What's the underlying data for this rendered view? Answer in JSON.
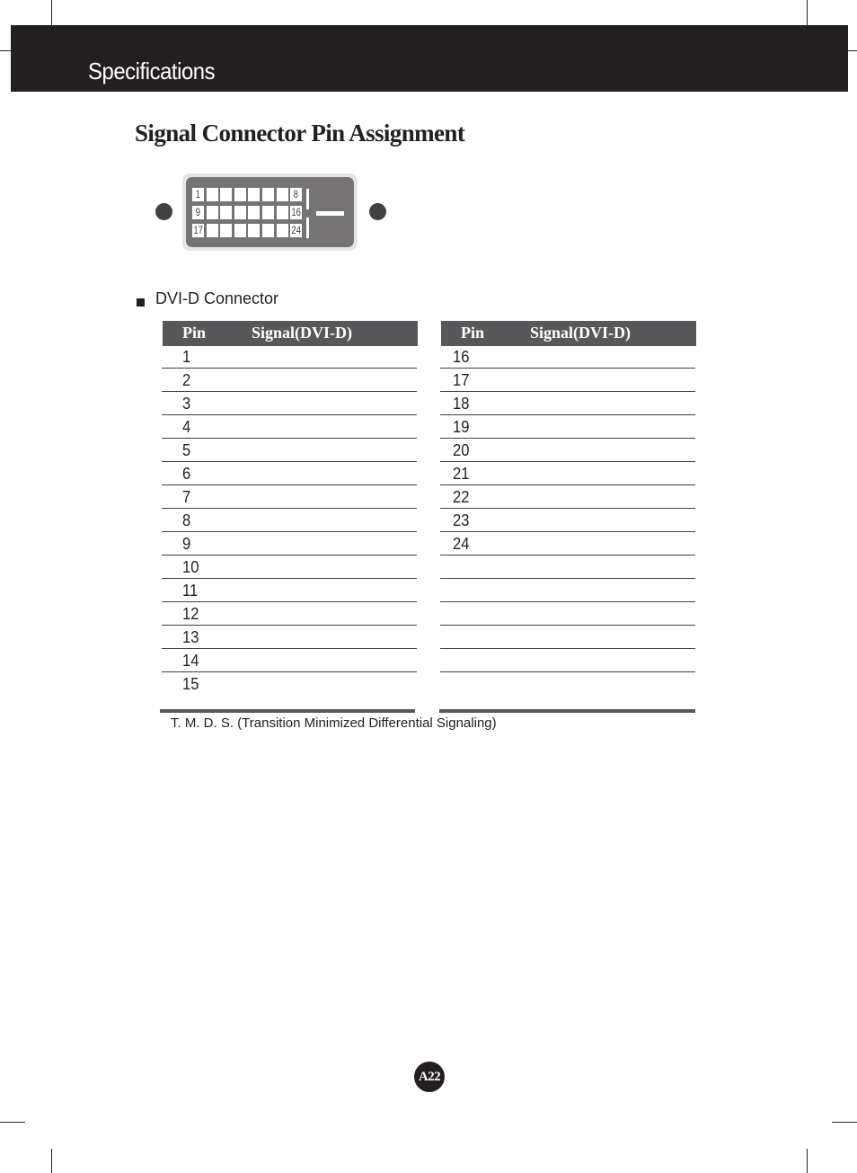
{
  "header": {
    "title": "Specifications"
  },
  "page_title": "Signal Connector Pin Assignment",
  "connector_diagram": {
    "pin_labels": {
      "row1_first": "1",
      "row1_last": "8",
      "row2_first": "9",
      "row2_last": "16",
      "row3_first": "17",
      "row3_last": "24"
    }
  },
  "section": {
    "label": "DVI-D Connector"
  },
  "tables": {
    "left": {
      "headers": {
        "pin": "Pin",
        "signal": "Signal(DVI-D)"
      },
      "rows": [
        {
          "pin": "1",
          "signal": ""
        },
        {
          "pin": "2",
          "signal": ""
        },
        {
          "pin": "3",
          "signal": ""
        },
        {
          "pin": "4",
          "signal": ""
        },
        {
          "pin": "5",
          "signal": ""
        },
        {
          "pin": "6",
          "signal": ""
        },
        {
          "pin": "7",
          "signal": ""
        },
        {
          "pin": "8",
          "signal": ""
        },
        {
          "pin": "9",
          "signal": ""
        },
        {
          "pin": "10",
          "signal": ""
        },
        {
          "pin": "11",
          "signal": ""
        },
        {
          "pin": "12",
          "signal": ""
        },
        {
          "pin": "13",
          "signal": ""
        },
        {
          "pin": "14",
          "signal": ""
        },
        {
          "pin": "15",
          "signal": ""
        }
      ]
    },
    "right": {
      "headers": {
        "pin": "Pin",
        "signal": "Signal(DVI-D)"
      },
      "rows": [
        {
          "pin": "16",
          "signal": ""
        },
        {
          "pin": "17",
          "signal": ""
        },
        {
          "pin": "18",
          "signal": ""
        },
        {
          "pin": "19",
          "signal": ""
        },
        {
          "pin": "20",
          "signal": ""
        },
        {
          "pin": "21",
          "signal": ""
        },
        {
          "pin": "22",
          "signal": ""
        },
        {
          "pin": "23",
          "signal": ""
        },
        {
          "pin": "24",
          "signal": ""
        },
        {
          "pin": "",
          "signal": ""
        },
        {
          "pin": "",
          "signal": ""
        },
        {
          "pin": "",
          "signal": ""
        },
        {
          "pin": "",
          "signal": ""
        },
        {
          "pin": "",
          "signal": ""
        },
        {
          "pin": "",
          "signal": ""
        }
      ]
    }
  },
  "footnote": "T. M. D. S. (Transition Minimized Differential Signaling)",
  "page_number": "A22"
}
